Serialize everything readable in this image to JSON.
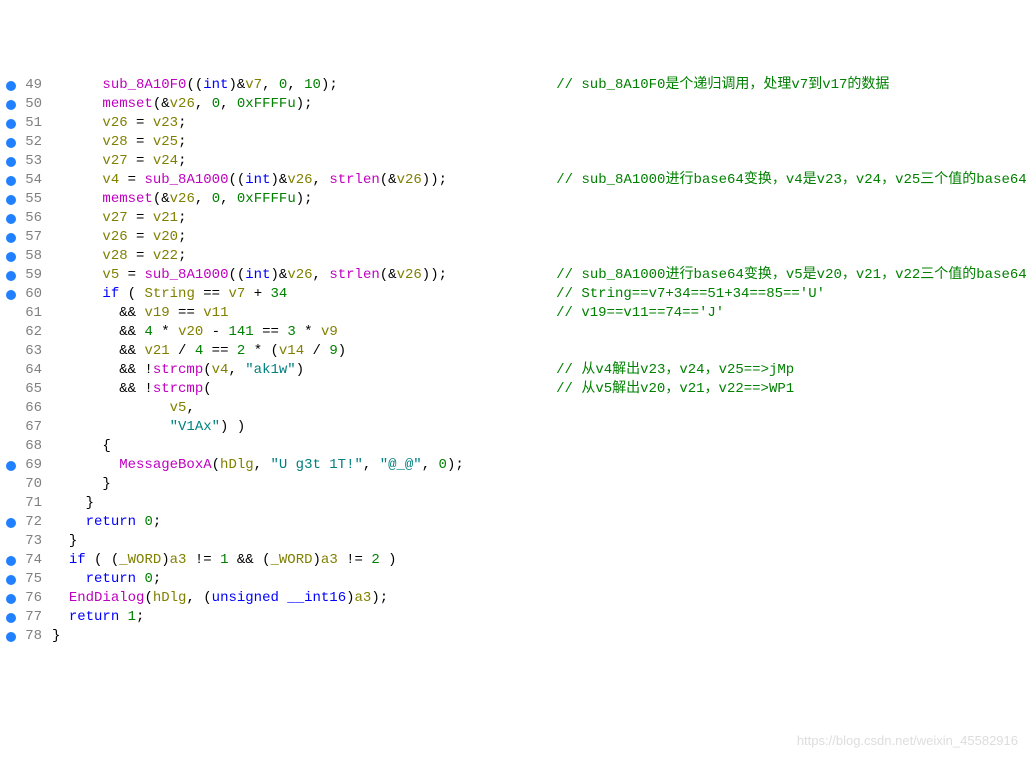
{
  "watermark": "https://blog.csdn.net/weixin_45582916",
  "lines": [
    {
      "n": 49,
      "bp": true,
      "indent": 3,
      "tokens": [
        [
          "fn",
          "sub_8A10F0"
        ],
        [
          "op",
          "(("
        ],
        [
          "kw",
          "int"
        ],
        [
          "op",
          ")&"
        ],
        [
          "var",
          "v7"
        ],
        [
          "op",
          ", "
        ],
        [
          "num-lit",
          "0"
        ],
        [
          "op",
          ", "
        ],
        [
          "num-lit",
          "10"
        ],
        [
          "op",
          ");"
        ]
      ],
      "comment_col": 60,
      "comment": "// sub_8A10F0是个递归调用，处理v7到v17的数据"
    },
    {
      "n": 50,
      "bp": true,
      "indent": 3,
      "tokens": [
        [
          "fn",
          "memset"
        ],
        [
          "op",
          "(&"
        ],
        [
          "var",
          "v26"
        ],
        [
          "op",
          ", "
        ],
        [
          "num-lit",
          "0"
        ],
        [
          "op",
          ", "
        ],
        [
          "num-lit",
          "0xFFFFu"
        ],
        [
          "op",
          ");"
        ]
      ]
    },
    {
      "n": 51,
      "bp": true,
      "indent": 3,
      "tokens": [
        [
          "var",
          "v26"
        ],
        [
          "op",
          " = "
        ],
        [
          "var",
          "v23"
        ],
        [
          "op",
          ";"
        ]
      ]
    },
    {
      "n": 52,
      "bp": true,
      "indent": 3,
      "tokens": [
        [
          "var",
          "v28"
        ],
        [
          "op",
          " = "
        ],
        [
          "var",
          "v25"
        ],
        [
          "op",
          ";"
        ]
      ]
    },
    {
      "n": 53,
      "bp": true,
      "indent": 3,
      "tokens": [
        [
          "var",
          "v27"
        ],
        [
          "op",
          " = "
        ],
        [
          "var",
          "v24"
        ],
        [
          "op",
          ";"
        ]
      ]
    },
    {
      "n": 54,
      "bp": true,
      "indent": 3,
      "tokens": [
        [
          "var",
          "v4"
        ],
        [
          "op",
          " = "
        ],
        [
          "fn",
          "sub_8A1000"
        ],
        [
          "op",
          "(("
        ],
        [
          "kw",
          "int"
        ],
        [
          "op",
          ")&"
        ],
        [
          "var",
          "v26"
        ],
        [
          "op",
          ", "
        ],
        [
          "fn",
          "strlen"
        ],
        [
          "op",
          "(&"
        ],
        [
          "var",
          "v26"
        ],
        [
          "op",
          "));"
        ]
      ],
      "comment_col": 60,
      "comment": "// sub_8A1000进行base64变换，v4是v23，v24，v25三个值的base64"
    },
    {
      "n": 55,
      "bp": true,
      "indent": 3,
      "tokens": [
        [
          "fn",
          "memset"
        ],
        [
          "op",
          "(&"
        ],
        [
          "var",
          "v26"
        ],
        [
          "op",
          ", "
        ],
        [
          "num-lit",
          "0"
        ],
        [
          "op",
          ", "
        ],
        [
          "num-lit",
          "0xFFFFu"
        ],
        [
          "op",
          ");"
        ]
      ]
    },
    {
      "n": 56,
      "bp": true,
      "indent": 3,
      "tokens": [
        [
          "var",
          "v27"
        ],
        [
          "op",
          " = "
        ],
        [
          "var",
          "v21"
        ],
        [
          "op",
          ";"
        ]
      ]
    },
    {
      "n": 57,
      "bp": true,
      "indent": 3,
      "tokens": [
        [
          "var",
          "v26"
        ],
        [
          "op",
          " = "
        ],
        [
          "var",
          "v20"
        ],
        [
          "op",
          ";"
        ]
      ]
    },
    {
      "n": 58,
      "bp": true,
      "indent": 3,
      "tokens": [
        [
          "var",
          "v28"
        ],
        [
          "op",
          " = "
        ],
        [
          "var",
          "v22"
        ],
        [
          "op",
          ";"
        ]
      ]
    },
    {
      "n": 59,
      "bp": true,
      "indent": 3,
      "tokens": [
        [
          "var",
          "v5"
        ],
        [
          "op",
          " = "
        ],
        [
          "fn",
          "sub_8A1000"
        ],
        [
          "op",
          "(("
        ],
        [
          "kw",
          "int"
        ],
        [
          "op",
          ")&"
        ],
        [
          "var",
          "v26"
        ],
        [
          "op",
          ", "
        ],
        [
          "fn",
          "strlen"
        ],
        [
          "op",
          "(&"
        ],
        [
          "var",
          "v26"
        ],
        [
          "op",
          "));"
        ]
      ],
      "comment_col": 60,
      "comment": "// sub_8A1000进行base64变换，v5是v20，v21，v22三个值的base64"
    },
    {
      "n": 60,
      "bp": true,
      "indent": 3,
      "tokens": [
        [
          "kw",
          "if"
        ],
        [
          "op",
          " ( "
        ],
        [
          "var",
          "String"
        ],
        [
          "op",
          " == "
        ],
        [
          "var",
          "v7"
        ],
        [
          "op",
          " + "
        ],
        [
          "num-lit",
          "34"
        ]
      ],
      "comment_col": 60,
      "comment": "// String==v7+34==51+34==85=='U'"
    },
    {
      "n": 61,
      "bp": false,
      "indent": 4,
      "tokens": [
        [
          "op",
          "&& "
        ],
        [
          "var",
          "v19"
        ],
        [
          "op",
          " == "
        ],
        [
          "var",
          "v11"
        ]
      ],
      "comment_col": 60,
      "comment": "// v19==v11==74=='J'"
    },
    {
      "n": 62,
      "bp": false,
      "indent": 4,
      "tokens": [
        [
          "op",
          "&& "
        ],
        [
          "num-lit",
          "4"
        ],
        [
          "op",
          " * "
        ],
        [
          "var",
          "v20"
        ],
        [
          "op",
          " - "
        ],
        [
          "num-lit",
          "141"
        ],
        [
          "op",
          " == "
        ],
        [
          "num-lit",
          "3"
        ],
        [
          "op",
          " * "
        ],
        [
          "var",
          "v9"
        ]
      ]
    },
    {
      "n": 63,
      "bp": false,
      "indent": 4,
      "tokens": [
        [
          "op",
          "&& "
        ],
        [
          "var",
          "v21"
        ],
        [
          "op",
          " / "
        ],
        [
          "num-lit",
          "4"
        ],
        [
          "op",
          " == "
        ],
        [
          "num-lit",
          "2"
        ],
        [
          "op",
          " * ("
        ],
        [
          "var",
          "v14"
        ],
        [
          "op",
          " / "
        ],
        [
          "num-lit",
          "9"
        ],
        [
          "op",
          ")"
        ]
      ]
    },
    {
      "n": 64,
      "bp": false,
      "indent": 4,
      "tokens": [
        [
          "op",
          "&& !"
        ],
        [
          "fn",
          "strcmp"
        ],
        [
          "op",
          "("
        ],
        [
          "var",
          "v4"
        ],
        [
          "op",
          ", "
        ],
        [
          "str",
          "\"ak1w\""
        ],
        [
          "op",
          ")"
        ]
      ],
      "comment_col": 60,
      "comment": "// 从v4解出v23，v24，v25==>jMp"
    },
    {
      "n": 65,
      "bp": false,
      "indent": 4,
      "tokens": [
        [
          "op",
          "&& !"
        ],
        [
          "fn",
          "strcmp"
        ],
        [
          "op",
          "("
        ]
      ],
      "comment_col": 60,
      "comment": "// 从v5解出v20，v21，v22==>WP1"
    },
    {
      "n": 66,
      "bp": false,
      "indent": 7,
      "tokens": [
        [
          "var",
          "v5"
        ],
        [
          "op",
          ","
        ]
      ]
    },
    {
      "n": 67,
      "bp": false,
      "indent": 7,
      "tokens": [
        [
          "str",
          "\"V1Ax\""
        ],
        [
          "op",
          ") )"
        ]
      ]
    },
    {
      "n": 68,
      "bp": false,
      "indent": 3,
      "tokens": [
        [
          "op",
          "{"
        ]
      ]
    },
    {
      "n": 69,
      "bp": true,
      "indent": 4,
      "tokens": [
        [
          "fn",
          "MessageBoxA"
        ],
        [
          "op",
          "("
        ],
        [
          "var",
          "hDlg"
        ],
        [
          "op",
          ", "
        ],
        [
          "str",
          "\"U g3t 1T!\""
        ],
        [
          "op",
          ", "
        ],
        [
          "str",
          "\"@_@\""
        ],
        [
          "op",
          ", "
        ],
        [
          "num-lit",
          "0"
        ],
        [
          "op",
          ");"
        ]
      ]
    },
    {
      "n": 70,
      "bp": false,
      "indent": 3,
      "tokens": [
        [
          "op",
          "}"
        ]
      ]
    },
    {
      "n": 71,
      "bp": false,
      "indent": 2,
      "tokens": [
        [
          "op",
          "}"
        ]
      ]
    },
    {
      "n": 72,
      "bp": true,
      "indent": 2,
      "tokens": [
        [
          "kw",
          "return"
        ],
        [
          "op",
          " "
        ],
        [
          "num-lit",
          "0"
        ],
        [
          "op",
          ";"
        ]
      ]
    },
    {
      "n": 73,
      "bp": false,
      "indent": 1,
      "tokens": [
        [
          "op",
          "}"
        ]
      ]
    },
    {
      "n": 74,
      "bp": true,
      "indent": 1,
      "tokens": [
        [
          "kw",
          "if"
        ],
        [
          "op",
          " ( ("
        ],
        [
          "var",
          "_WORD"
        ],
        [
          "op",
          ")"
        ],
        [
          "var",
          "a3"
        ],
        [
          "op",
          " != "
        ],
        [
          "num-lit",
          "1"
        ],
        [
          "op",
          " && ("
        ],
        [
          "var",
          "_WORD"
        ],
        [
          "op",
          ")"
        ],
        [
          "var",
          "a3"
        ],
        [
          "op",
          " != "
        ],
        [
          "num-lit",
          "2"
        ],
        [
          "op",
          " )"
        ]
      ]
    },
    {
      "n": 75,
      "bp": true,
      "indent": 2,
      "tokens": [
        [
          "kw",
          "return"
        ],
        [
          "op",
          " "
        ],
        [
          "num-lit",
          "0"
        ],
        [
          "op",
          ";"
        ]
      ]
    },
    {
      "n": 76,
      "bp": true,
      "indent": 1,
      "tokens": [
        [
          "fn",
          "EndDialog"
        ],
        [
          "op",
          "("
        ],
        [
          "var",
          "hDlg"
        ],
        [
          "op",
          ", ("
        ],
        [
          "kw",
          "unsigned"
        ],
        [
          "op",
          " "
        ],
        [
          "kw",
          "__int16"
        ],
        [
          "op",
          ")"
        ],
        [
          "var",
          "a3"
        ],
        [
          "op",
          ");"
        ]
      ]
    },
    {
      "n": 77,
      "bp": true,
      "indent": 1,
      "tokens": [
        [
          "kw",
          "return"
        ],
        [
          "op",
          " "
        ],
        [
          "num-lit",
          "1"
        ],
        [
          "op",
          ";"
        ]
      ]
    },
    {
      "n": 78,
      "bp": true,
      "indent": 0,
      "tokens": [
        [
          "op",
          "}"
        ]
      ]
    }
  ]
}
